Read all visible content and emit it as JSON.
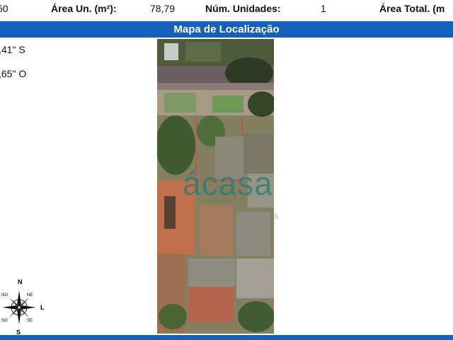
{
  "header_row": {
    "partial_left_value": "50",
    "area_un_label": "Área Un. (m²):",
    "area_un_value": "78,79",
    "num_unidades_label": "Núm. Unidades:",
    "num_unidades_value": "1",
    "area_total_label": "Área Total. (m"
  },
  "banner_title": "Mapa de Localização",
  "coordinates": {
    "latitude_partial": ",41\" S",
    "longitude_partial": ",65\" O"
  },
  "watermark": {
    "main": "ácasa",
    "sub": "ia"
  },
  "compass": {
    "n": "N",
    "s": "S",
    "l": "L",
    "ne": "NE",
    "no": "NO",
    "se": "SE",
    "so": "SO"
  },
  "colors": {
    "banner": "#1560b8",
    "watermark": "#1e7d78"
  }
}
